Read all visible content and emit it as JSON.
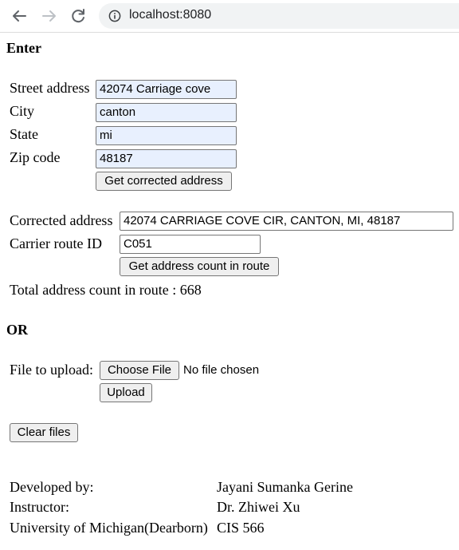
{
  "browser": {
    "url": "localhost:8080"
  },
  "form": {
    "heading": "Enter",
    "street_label": "Street address",
    "street_value": "42074 Carriage cove",
    "city_label": "City",
    "city_value": "canton",
    "state_label": "State",
    "state_value": "mi",
    "zip_label": "Zip code",
    "zip_value": "48187",
    "get_corrected_label": "Get corrected address"
  },
  "result": {
    "corrected_label": "Corrected address",
    "corrected_value": "42074 CARRIAGE COVE CIR, CANTON, MI, 48187",
    "route_label": "Carrier route ID",
    "route_value": "C051",
    "count_button_label": "Get address count in route",
    "total_text": "Total address count in route : 668"
  },
  "upload": {
    "or_heading": "OR",
    "file_label": "File to upload:",
    "choose_file_label": "Choose File",
    "no_file_text": "No file chosen",
    "upload_button_label": "Upload",
    "clear_button_label": "Clear files"
  },
  "footer": {
    "developed_by_label": "Developed by:",
    "developer_name": "Jayani Sumanka Gerine",
    "instructor_label": "Instructor:",
    "instructor_name": "Dr. Zhiwei Xu",
    "university": "University of Michigan(Dearborn)",
    "course": "CIS 566"
  }
}
